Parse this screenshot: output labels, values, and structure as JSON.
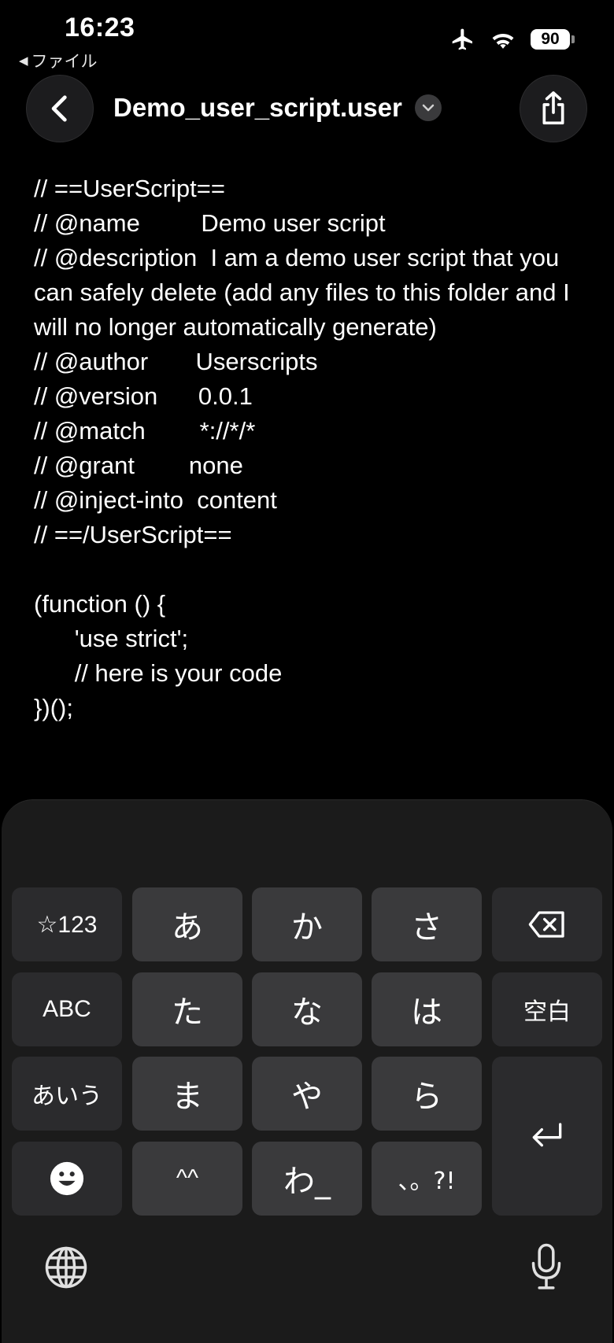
{
  "status_bar": {
    "time": "16:23",
    "back_app": "ファイル",
    "battery": "90",
    "icons": [
      "airplane-icon",
      "wifi-icon",
      "battery-icon"
    ]
  },
  "nav": {
    "title": "Demo_user_script.user",
    "back_icon": "chevron-left-icon",
    "share_icon": "share-icon",
    "title_menu_icon": "chevron-down-icon"
  },
  "code_lines": [
    "// ==UserScript==",
    "// @name         Demo user script",
    "// @description  I am a demo user script that you can safely delete (add any files to this folder and I will no longer automatically generate)",
    "// @author       Userscripts",
    "// @version      0.0.1",
    "// @match        *://*/*",
    "// @grant        none",
    "// @inject-into  content",
    "// ==/UserScript==",
    "",
    "(function () {",
    "      'use strict';",
    "      // here is your code",
    "})();"
  ],
  "keyboard": {
    "row1": [
      "☆123",
      "あ",
      "か",
      "さ"
    ],
    "row2": [
      "ABC",
      "た",
      "な",
      "は",
      "空白"
    ],
    "row3": [
      "あいう",
      "ま",
      "や",
      "ら"
    ],
    "row4": [
      "^^",
      "わ_",
      "、。?!"
    ],
    "backspace_icon": "backspace-icon",
    "enter_icon": "return-icon",
    "emoji_icon": "emoji-icon",
    "globe_icon": "globe-icon",
    "mic_icon": "microphone-icon"
  },
  "colors": {
    "background": "#000000",
    "keyboard_bg": "#1b1b1b",
    "key_bg": "#3a3a3c",
    "func_key_bg": "#2b2b2d"
  }
}
